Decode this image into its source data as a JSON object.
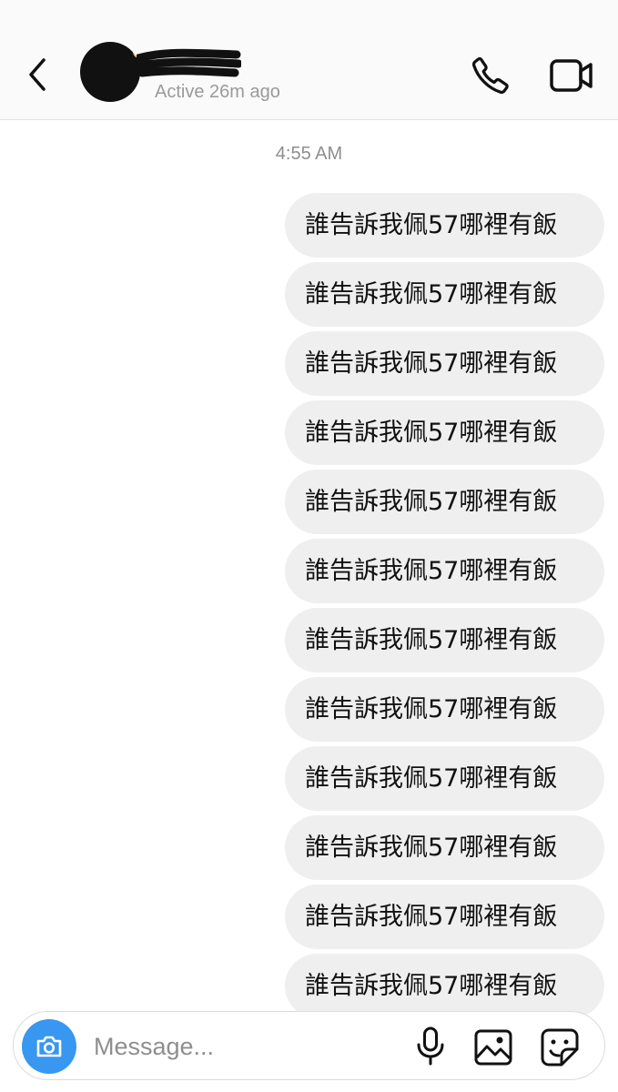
{
  "header": {
    "status": "Active 26m ago"
  },
  "timestamp": "4:55 AM",
  "messages": [
    "誰告訴我佩57哪裡有飯",
    "誰告訴我佩57哪裡有飯",
    "誰告訴我佩57哪裡有飯",
    "誰告訴我佩57哪裡有飯",
    "誰告訴我佩57哪裡有飯",
    "誰告訴我佩57哪裡有飯",
    "誰告訴我佩57哪裡有飯",
    "誰告訴我佩57哪裡有飯",
    "誰告訴我佩57哪裡有飯",
    "誰告訴我佩57哪裡有飯",
    "誰告訴我佩57哪裡有飯",
    "誰告訴我佩57哪裡有飯"
  ],
  "composer": {
    "placeholder": "Message..."
  },
  "colors": {
    "accent": "#3897f0",
    "bubble": "#efefef",
    "muted_text": "#8e8e8e"
  },
  "icons": [
    "back-chevron-icon",
    "phone-icon",
    "video-camera-icon",
    "camera-icon",
    "microphone-icon",
    "gallery-icon",
    "sticker-icon"
  ]
}
